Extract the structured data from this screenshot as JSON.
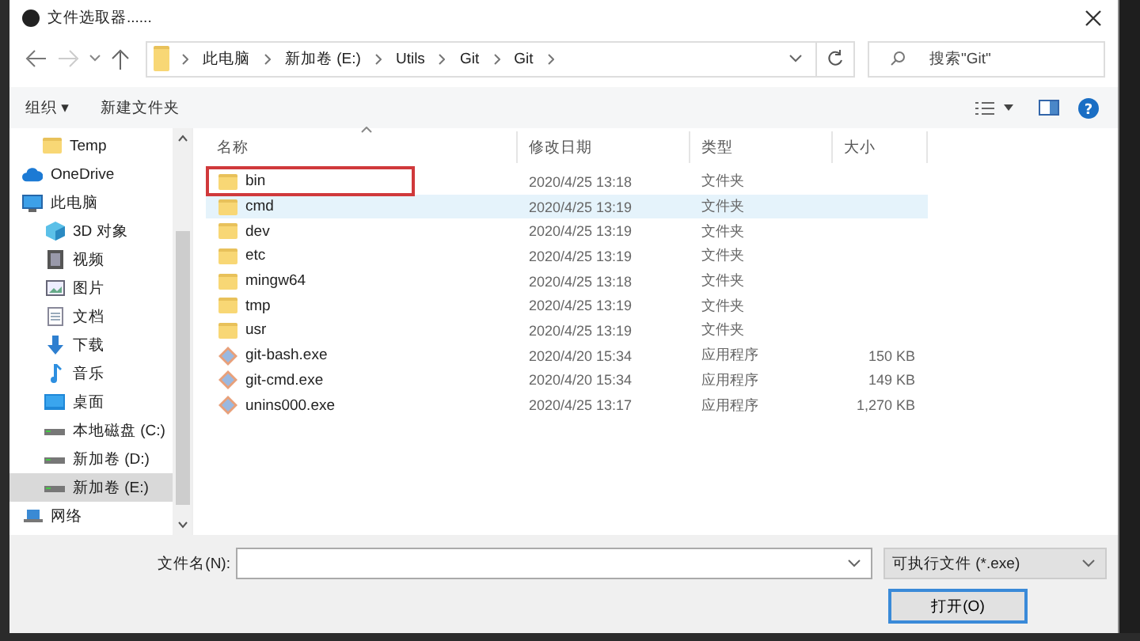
{
  "window": {
    "title": "文件选取器......"
  },
  "address": {
    "path": [
      "此电脑",
      "新加卷 (E:)",
      "Utils",
      "Git",
      "Git"
    ]
  },
  "search": {
    "placeholder": "搜索\"Git\""
  },
  "toolbar": {
    "items": [
      "组织 ▾",
      "新建文件夹"
    ],
    "help": "?"
  },
  "sidebar": {
    "items": [
      {
        "label": "Temp",
        "kind": "folder",
        "selected": false
      },
      {
        "label": "OneDrive",
        "kind": "cloud",
        "selected": false
      },
      {
        "label": "此电脑",
        "kind": "pc",
        "selected": false
      },
      {
        "label": "3D 对象",
        "kind": "cube",
        "selected": false
      },
      {
        "label": "视频",
        "kind": "video",
        "selected": false
      },
      {
        "label": "图片",
        "kind": "picture",
        "selected": false
      },
      {
        "label": "文档",
        "kind": "doc",
        "selected": false
      },
      {
        "label": "下载",
        "kind": "download",
        "selected": false
      },
      {
        "label": "音乐",
        "kind": "music",
        "selected": false
      },
      {
        "label": "桌面",
        "kind": "desktop",
        "selected": false
      },
      {
        "label": "本地磁盘 (C:)",
        "kind": "drive",
        "selected": false
      },
      {
        "label": "新加卷 (D:)",
        "kind": "drive",
        "selected": false
      },
      {
        "label": "新加卷 (E:)",
        "kind": "drive",
        "selected": true
      },
      {
        "label": "网络",
        "kind": "network",
        "selected": false
      }
    ]
  },
  "table": {
    "columns": [
      "名称",
      "修改日期",
      "类型",
      "大小"
    ],
    "rows": [
      {
        "name": "bin",
        "date": "2020/4/25 13:18",
        "type": "文件夹",
        "kind": "folder",
        "hovered": false,
        "marked": true
      },
      {
        "name": "cmd",
        "date": "2020/4/25 13:19",
        "type": "文件夹",
        "kind": "folder",
        "hovered": true,
        "marked": false
      },
      {
        "name": "dev",
        "date": "2020/4/25 13:19",
        "type": "文件夹",
        "kind": "folder",
        "hovered": false,
        "marked": false
      },
      {
        "name": "etc",
        "date": "2020/4/25 13:19",
        "type": "文件夹",
        "kind": "folder",
        "hovered": false,
        "marked": false
      },
      {
        "name": "mingw64",
        "date": "2020/4/25 13:18",
        "type": "文件夹",
        "kind": "folder",
        "hovered": false,
        "marked": false
      },
      {
        "name": "tmp",
        "date": "2020/4/25 13:19",
        "type": "文件夹",
        "kind": "folder",
        "hovered": false,
        "marked": false
      },
      {
        "name": "usr",
        "date": "2020/4/25 13:19",
        "type": "文件夹",
        "kind": "folder",
        "hovered": false,
        "marked": false
      },
      {
        "name": "git-bash.exe",
        "date": "2020/4/20 15:34",
        "type": "应用程序",
        "size": "150 KB",
        "kind": "exe",
        "hovered": false,
        "marked": false
      },
      {
        "name": "git-cmd.exe",
        "date": "2020/4/20 15:34",
        "type": "应用程序",
        "size": "149 KB",
        "kind": "exe",
        "hovered": false,
        "marked": false
      },
      {
        "name": "unins000.exe",
        "date": "2020/4/25 13:17",
        "type": "应用程序",
        "size": "1,270 KB",
        "kind": "exe",
        "hovered": false,
        "marked": false
      }
    ]
  },
  "footer": {
    "filename_label": "文件名(N):",
    "filetype": "可执行文件 (*.exe)",
    "open_button": "打开(O)"
  }
}
